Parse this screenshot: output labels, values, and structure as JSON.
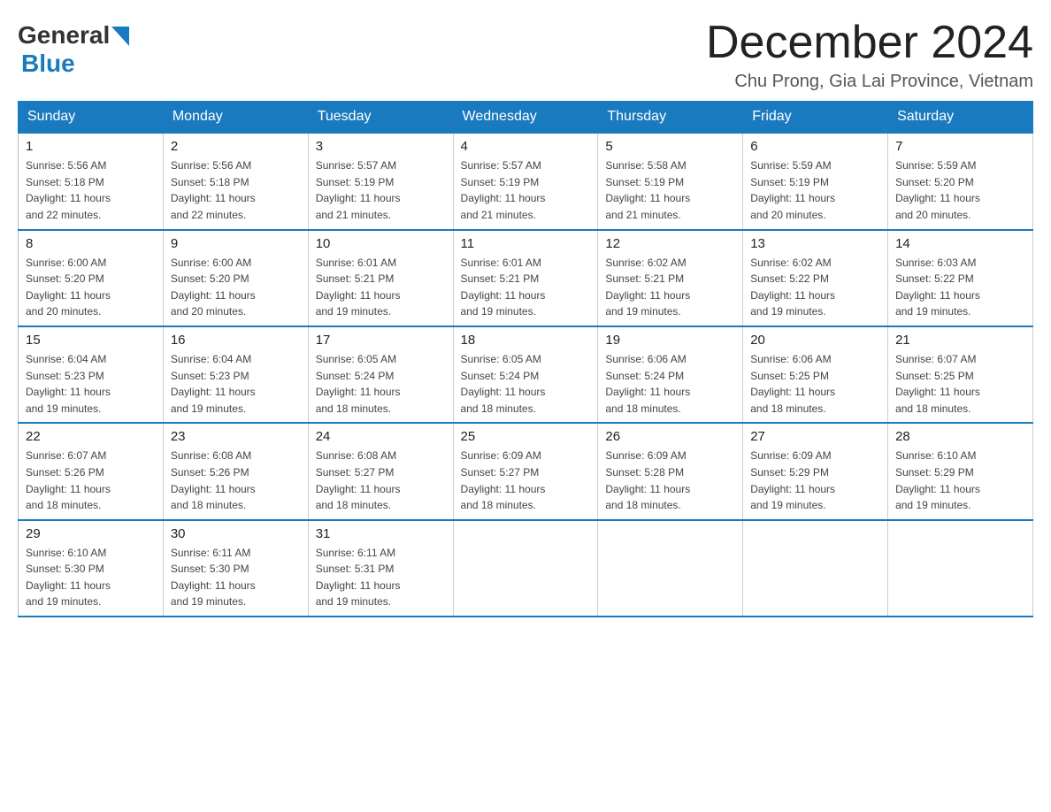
{
  "header": {
    "logo_general": "General",
    "logo_blue": "Blue",
    "main_title": "December 2024",
    "sub_title": "Chu Prong, Gia Lai Province, Vietnam"
  },
  "calendar": {
    "columns": [
      "Sunday",
      "Monday",
      "Tuesday",
      "Wednesday",
      "Thursday",
      "Friday",
      "Saturday"
    ],
    "rows": [
      [
        {
          "day": "1",
          "sunrise": "5:56 AM",
          "sunset": "5:18 PM",
          "daylight": "11 hours and 22 minutes."
        },
        {
          "day": "2",
          "sunrise": "5:56 AM",
          "sunset": "5:18 PM",
          "daylight": "11 hours and 22 minutes."
        },
        {
          "day": "3",
          "sunrise": "5:57 AM",
          "sunset": "5:19 PM",
          "daylight": "11 hours and 21 minutes."
        },
        {
          "day": "4",
          "sunrise": "5:57 AM",
          "sunset": "5:19 PM",
          "daylight": "11 hours and 21 minutes."
        },
        {
          "day": "5",
          "sunrise": "5:58 AM",
          "sunset": "5:19 PM",
          "daylight": "11 hours and 21 minutes."
        },
        {
          "day": "6",
          "sunrise": "5:59 AM",
          "sunset": "5:19 PM",
          "daylight": "11 hours and 20 minutes."
        },
        {
          "day": "7",
          "sunrise": "5:59 AM",
          "sunset": "5:20 PM",
          "daylight": "11 hours and 20 minutes."
        }
      ],
      [
        {
          "day": "8",
          "sunrise": "6:00 AM",
          "sunset": "5:20 PM",
          "daylight": "11 hours and 20 minutes."
        },
        {
          "day": "9",
          "sunrise": "6:00 AM",
          "sunset": "5:20 PM",
          "daylight": "11 hours and 20 minutes."
        },
        {
          "day": "10",
          "sunrise": "6:01 AM",
          "sunset": "5:21 PM",
          "daylight": "11 hours and 19 minutes."
        },
        {
          "day": "11",
          "sunrise": "6:01 AM",
          "sunset": "5:21 PM",
          "daylight": "11 hours and 19 minutes."
        },
        {
          "day": "12",
          "sunrise": "6:02 AM",
          "sunset": "5:21 PM",
          "daylight": "11 hours and 19 minutes."
        },
        {
          "day": "13",
          "sunrise": "6:02 AM",
          "sunset": "5:22 PM",
          "daylight": "11 hours and 19 minutes."
        },
        {
          "day": "14",
          "sunrise": "6:03 AM",
          "sunset": "5:22 PM",
          "daylight": "11 hours and 19 minutes."
        }
      ],
      [
        {
          "day": "15",
          "sunrise": "6:04 AM",
          "sunset": "5:23 PM",
          "daylight": "11 hours and 19 minutes."
        },
        {
          "day": "16",
          "sunrise": "6:04 AM",
          "sunset": "5:23 PM",
          "daylight": "11 hours and 19 minutes."
        },
        {
          "day": "17",
          "sunrise": "6:05 AM",
          "sunset": "5:24 PM",
          "daylight": "11 hours and 18 minutes."
        },
        {
          "day": "18",
          "sunrise": "6:05 AM",
          "sunset": "5:24 PM",
          "daylight": "11 hours and 18 minutes."
        },
        {
          "day": "19",
          "sunrise": "6:06 AM",
          "sunset": "5:24 PM",
          "daylight": "11 hours and 18 minutes."
        },
        {
          "day": "20",
          "sunrise": "6:06 AM",
          "sunset": "5:25 PM",
          "daylight": "11 hours and 18 minutes."
        },
        {
          "day": "21",
          "sunrise": "6:07 AM",
          "sunset": "5:25 PM",
          "daylight": "11 hours and 18 minutes."
        }
      ],
      [
        {
          "day": "22",
          "sunrise": "6:07 AM",
          "sunset": "5:26 PM",
          "daylight": "11 hours and 18 minutes."
        },
        {
          "day": "23",
          "sunrise": "6:08 AM",
          "sunset": "5:26 PM",
          "daylight": "11 hours and 18 minutes."
        },
        {
          "day": "24",
          "sunrise": "6:08 AM",
          "sunset": "5:27 PM",
          "daylight": "11 hours and 18 minutes."
        },
        {
          "day": "25",
          "sunrise": "6:09 AM",
          "sunset": "5:27 PM",
          "daylight": "11 hours and 18 minutes."
        },
        {
          "day": "26",
          "sunrise": "6:09 AM",
          "sunset": "5:28 PM",
          "daylight": "11 hours and 18 minutes."
        },
        {
          "day": "27",
          "sunrise": "6:09 AM",
          "sunset": "5:29 PM",
          "daylight": "11 hours and 19 minutes."
        },
        {
          "day": "28",
          "sunrise": "6:10 AM",
          "sunset": "5:29 PM",
          "daylight": "11 hours and 19 minutes."
        }
      ],
      [
        {
          "day": "29",
          "sunrise": "6:10 AM",
          "sunset": "5:30 PM",
          "daylight": "11 hours and 19 minutes."
        },
        {
          "day": "30",
          "sunrise": "6:11 AM",
          "sunset": "5:30 PM",
          "daylight": "11 hours and 19 minutes."
        },
        {
          "day": "31",
          "sunrise": "6:11 AM",
          "sunset": "5:31 PM",
          "daylight": "11 hours and 19 minutes."
        },
        null,
        null,
        null,
        null
      ]
    ],
    "sunrise_label": "Sunrise:",
    "sunset_label": "Sunset:",
    "daylight_label": "Daylight:"
  }
}
